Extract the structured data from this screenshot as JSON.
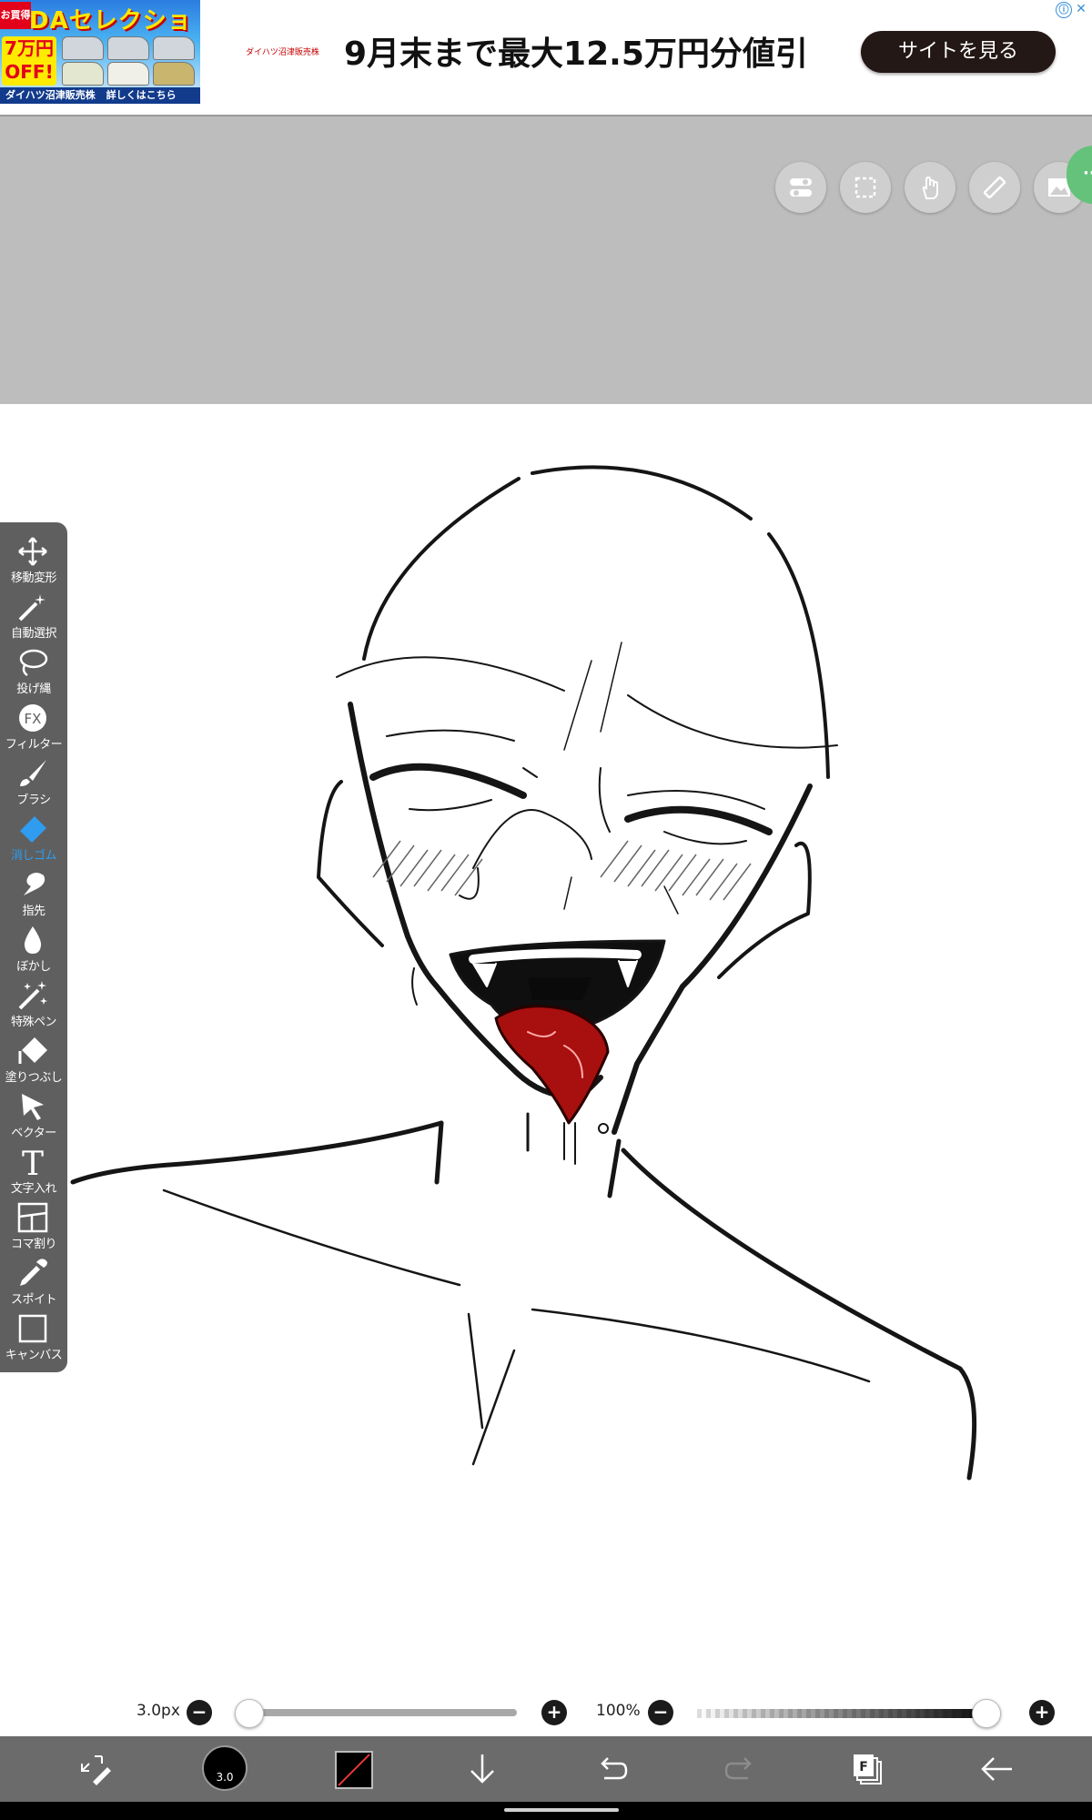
{
  "ad": {
    "thumb_headline": "DAセレクション",
    "thumb_tag": "お買得",
    "thumb_discount": "7万円 OFF!",
    "thumb_dealer": "ダイハツ沼津販売株",
    "thumb_link": "詳しくはこちら",
    "logo_text": "ダイハツ沼津販売株",
    "headline": "9月末まで最大12.5万円分値引",
    "cta_label": "サイトを見る",
    "info_icon": "ⓘ",
    "close_icon": "✕"
  },
  "top_tools": [
    {
      "name": "toggle-icon"
    },
    {
      "name": "selection-icon"
    },
    {
      "name": "hand-icon"
    },
    {
      "name": "ruler-icon"
    },
    {
      "name": "image-icon"
    }
  ],
  "green_tab_label": "··",
  "left_toolbar": [
    {
      "label": "移動変形",
      "icon": "move-icon",
      "active": false
    },
    {
      "label": "自動選択",
      "icon": "magic-wand-icon",
      "active": false
    },
    {
      "label": "投げ縄",
      "icon": "lasso-icon",
      "active": false
    },
    {
      "label": "フィルター",
      "icon": "fx-icon",
      "active": false
    },
    {
      "label": "ブラシ",
      "icon": "brush-icon",
      "active": false
    },
    {
      "label": "消しゴム",
      "icon": "eraser-icon",
      "active": true
    },
    {
      "label": "指先",
      "icon": "finger-icon",
      "active": false
    },
    {
      "label": "ぼかし",
      "icon": "blur-drop-icon",
      "active": false
    },
    {
      "label": "特殊ペン",
      "icon": "special-pen-icon",
      "active": false
    },
    {
      "label": "塗りつぶし",
      "icon": "fill-bucket-icon",
      "active": false
    },
    {
      "label": "ベクター",
      "icon": "vector-cursor-icon",
      "active": false
    },
    {
      "label": "文字入れ",
      "icon": "text-icon",
      "active": false
    },
    {
      "label": "コマ割り",
      "icon": "panel-split-icon",
      "active": false
    },
    {
      "label": "スポイト",
      "icon": "eyedropper-icon",
      "active": false
    },
    {
      "label": "キャンバス",
      "icon": "canvas-icon",
      "active": false
    }
  ],
  "sliders": {
    "size_label": "3.0px",
    "size_value_fraction": 0.0,
    "opacity_label": "100%",
    "opacity_value_fraction": 1.0,
    "minus": "−",
    "plus": "+"
  },
  "bottom_bar": {
    "brush_size_text": "3.0",
    "layer_label": "F",
    "colors": {
      "primary": "#000000",
      "active_tool": "#2f9cf0",
      "tongue": "#a80f0f"
    }
  }
}
